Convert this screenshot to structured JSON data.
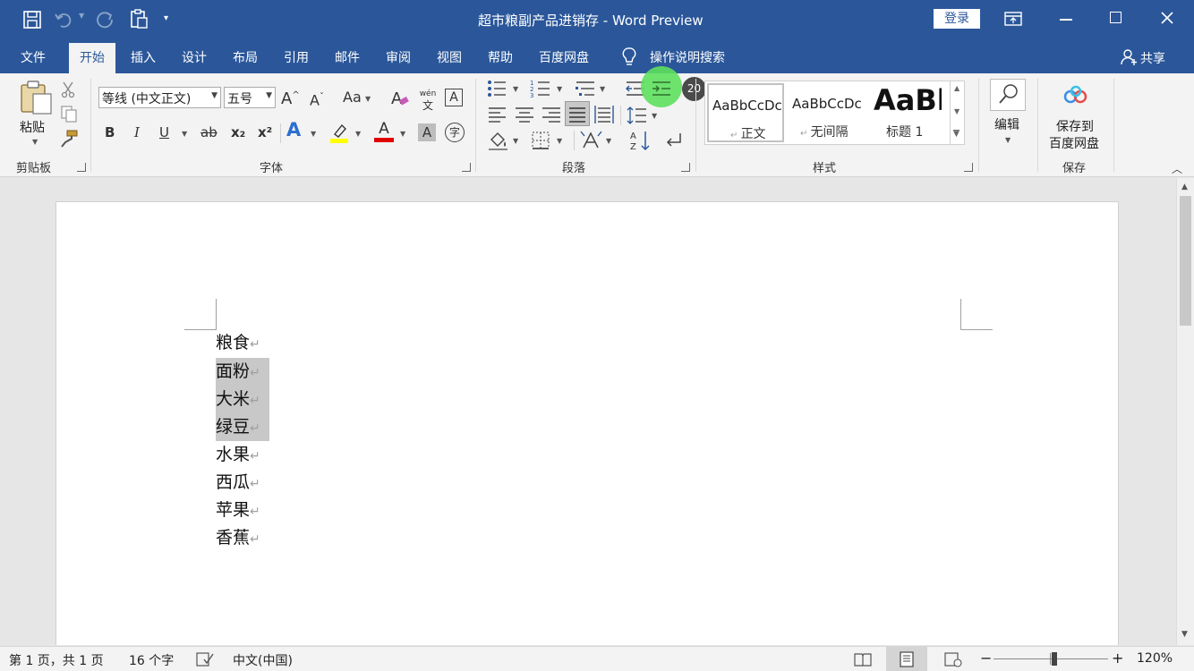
{
  "window": {
    "title": "超市粮副产品进销存  -  Word Preview",
    "login_label": "登录"
  },
  "tabs": [
    {
      "label": "文件"
    },
    {
      "label": "开始"
    },
    {
      "label": "插入"
    },
    {
      "label": "设计"
    },
    {
      "label": "布局"
    },
    {
      "label": "引用"
    },
    {
      "label": "邮件"
    },
    {
      "label": "审阅"
    },
    {
      "label": "视图"
    },
    {
      "label": "帮助"
    },
    {
      "label": "百度网盘"
    }
  ],
  "tell_me": "操作说明搜索",
  "share": "共享",
  "clipboard": {
    "paste": "粘贴",
    "group": "剪贴板"
  },
  "font": {
    "name": "等线 (中文正文)",
    "size": "五号",
    "group": "字体",
    "change_case": "Aa",
    "phonetic_top": "wén",
    "phonetic_bottom": "文",
    "char_border": "A",
    "bold": "B",
    "italic": "I",
    "underline": "U",
    "strike": "ab",
    "subscript": "x₂",
    "superscript": "x²",
    "text_effect": "A",
    "font_color": "A",
    "char_shading": "A",
    "enclose": "字"
  },
  "paragraph": {
    "group": "段落",
    "badge": "20"
  },
  "styles": {
    "group": "样式",
    "items": [
      {
        "preview": "AaBbCcDc",
        "name": "正文"
      },
      {
        "preview": "AaBbCcDc",
        "name": "无间隔"
      },
      {
        "preview": "AaBl",
        "name": "标题 1"
      }
    ]
  },
  "editing": {
    "label": "编辑"
  },
  "save": {
    "label_line1": "保存到",
    "label_line2": "百度网盘",
    "group": "保存"
  },
  "document": {
    "lines": [
      {
        "text": "粮食",
        "selected": false
      },
      {
        "text": "面粉",
        "selected": true
      },
      {
        "text": "大米",
        "selected": true
      },
      {
        "text": "绿豆",
        "selected": true
      },
      {
        "text": "水果",
        "selected": false
      },
      {
        "text": "西瓜",
        "selected": false
      },
      {
        "text": "苹果",
        "selected": false
      },
      {
        "text": "香蕉",
        "selected": false
      }
    ]
  },
  "status": {
    "page": "第 1 页，共 1 页",
    "words": "16 个字",
    "language": "中文(中国)",
    "zoom": "120%"
  },
  "colors": {
    "brand": "#2b579a",
    "highlight": "#ffff00",
    "font_color": "#e00000",
    "focus_ring": "#5ee05e"
  }
}
